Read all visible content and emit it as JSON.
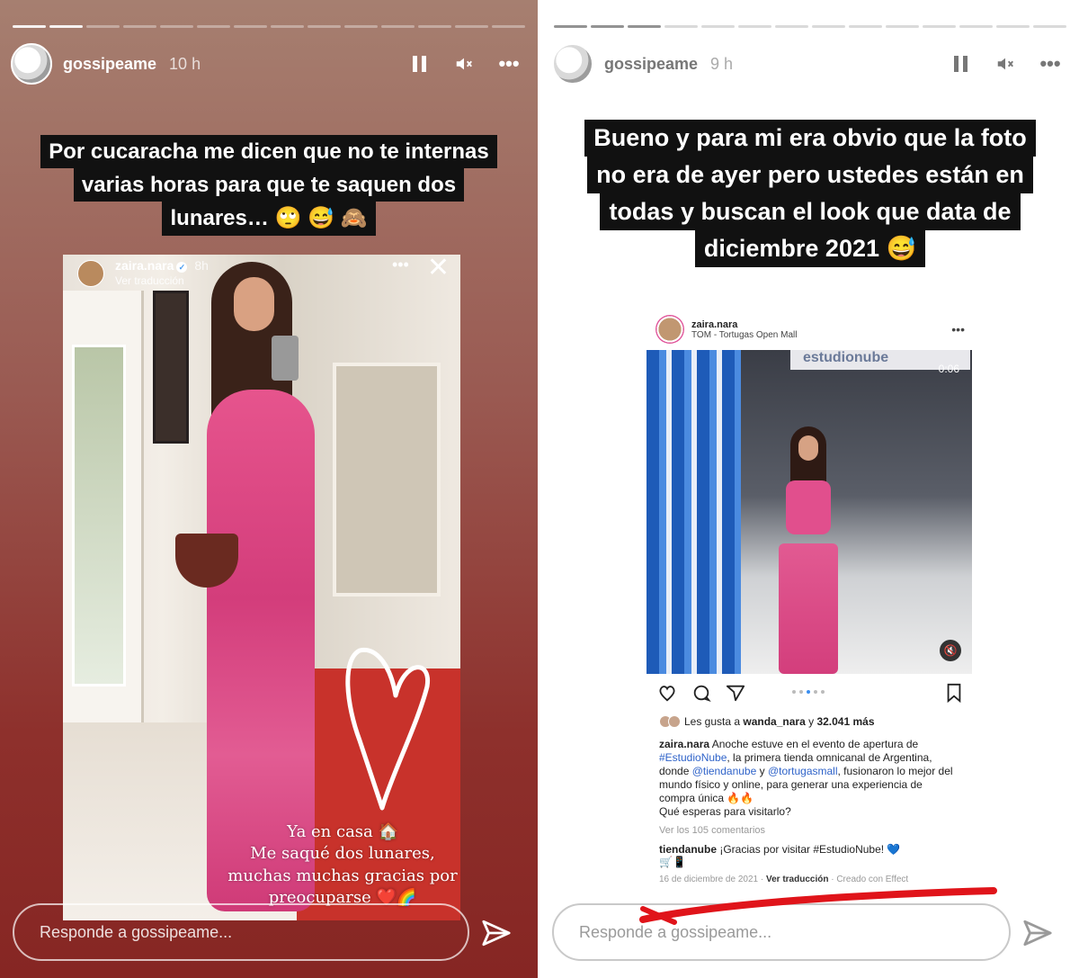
{
  "left_story": {
    "username": "gossipeame",
    "time": "10 h",
    "caption_lines": [
      "Por cucaracha me dicen que no te internas",
      "varias horas para que te saquen dos",
      "lunares… 🙄 😅 🙈"
    ],
    "embedded_story": {
      "username": "zaira.nara",
      "time": "8h",
      "translate": "Ver traducción",
      "sticker_lines": [
        "Ya en casa 🏠",
        "Me saqué dos lunares,",
        "muchas muchas gracias por",
        "preocuparse ❤️🌈"
      ]
    },
    "reply_placeholder": "Responde a gossipeame..."
  },
  "right_story": {
    "username": "gossipeame",
    "time": "9 h",
    "caption_lines": [
      "Bueno y para mi era obvio que la foto",
      "no era de ayer pero ustedes están en",
      "todas y buscan el look que data de",
      "diciembre 2021 😅"
    ],
    "post": {
      "username": "zaira.nara",
      "location": "TOM - Tortugas Open Mall",
      "store_sign": "estudionube",
      "timer": "0:06",
      "likes_prefix": "Les gusta a ",
      "likes_user": "wanda_nara",
      "likes_mid": " y ",
      "likes_count": "32.041 más",
      "caption": {
        "user": "zaira.nara",
        "p1": " Anoche estuve en el evento de apertura de ",
        "tag1": "#EstudioNube",
        "p2": ", la primera tienda omnicanal de Argentina, donde ",
        "m1": "@tiendanube",
        "p3": " y ",
        "m2": "@tortugasmall",
        "p4": ", fusionaron lo mejor del mundo físico y online, para generar una experiencia de compra única 🔥🔥",
        "p5": "Qué esperas para visitarlo?"
      },
      "view_comments": "Ver los 105 comentarios",
      "comment_user": "tiendanube",
      "comment_text": " ¡Gracias por visitar #EstudioNube! 💙",
      "comment_emoji": "🛒📱",
      "date": "16 de diciembre de 2021",
      "footer_sep": " · ",
      "footer_translate": "Ver traducción",
      "footer_created": "Creado con Effect"
    },
    "reply_placeholder": "Responde a gossipeame..."
  },
  "colors": {
    "left_bg_top": "#a67f70",
    "left_bg_bottom": "#862623",
    "caption_bg": "#111111",
    "link_blue": "#2f63c9",
    "annotation_red": "#e0141a"
  },
  "icons": {
    "pause": "pause-icon",
    "mute": "mute-icon",
    "more": "more-icon",
    "send": "send-icon",
    "close": "close-icon",
    "heart": "heart-icon",
    "comment": "comment-icon",
    "share": "share-icon",
    "save": "bookmark-icon"
  }
}
